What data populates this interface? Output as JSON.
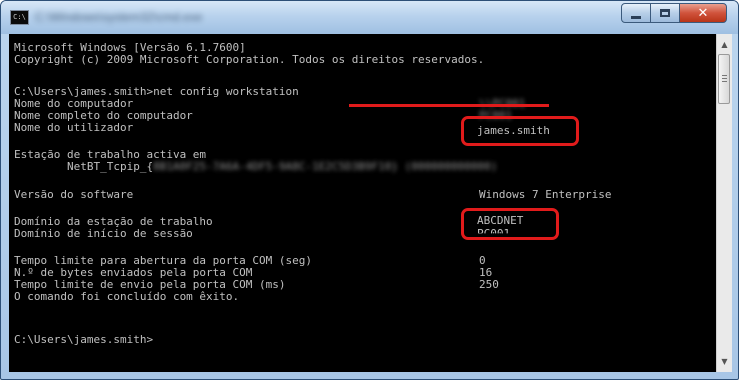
{
  "window": {
    "title": "C:\\Windows\\system32\\cmd.exe",
    "icon_label": "C:\\",
    "controls": {
      "minimize": "minimize",
      "maximize": "maximize",
      "close": "✕"
    }
  },
  "console": {
    "lines": [
      "Microsoft Windows [Versão 6.1.7600]",
      "Copyright (c) 2009 Microsoft Corporation. Todos os direitos reservados.",
      "",
      "C:\\Users\\james.smith>net config workstation",
      "Nome do computador",
      "Nome completo do computador",
      "Nome do utilizador",
      "Estação de trabalho activa em",
      "        NetBT_Tcpip_{",
      "Versão do software",
      "Domínio da estação de trabalho",
      "Domínio de início de sessão",
      "Tempo limite para abertura da porta COM (seg)",
      "N.º de bytes enviados pela porta COM",
      "Tempo limite de envio pela porta COM (ms)",
      "O comando foi concluído com êxito.",
      "C:\\Users\\james.smith>"
    ],
    "values": {
      "computer_name": "\\\\PC001",
      "full_computer_name": "PC001",
      "user_name": "james.smith",
      "netbt_guid": "8B1A0F25-7A6A-4DF5-9A8C-1E2C5D3B9F10} (000000000000)",
      "software_version": "Windows 7 Enterprise",
      "workstation_domain": "ABCDNET",
      "logon_domain": "PC001",
      "com_open_timeout": "0",
      "com_bytes": "16",
      "com_send_timeout": "250"
    }
  },
  "annotations": {
    "highlight_color": "#e11b1b"
  }
}
